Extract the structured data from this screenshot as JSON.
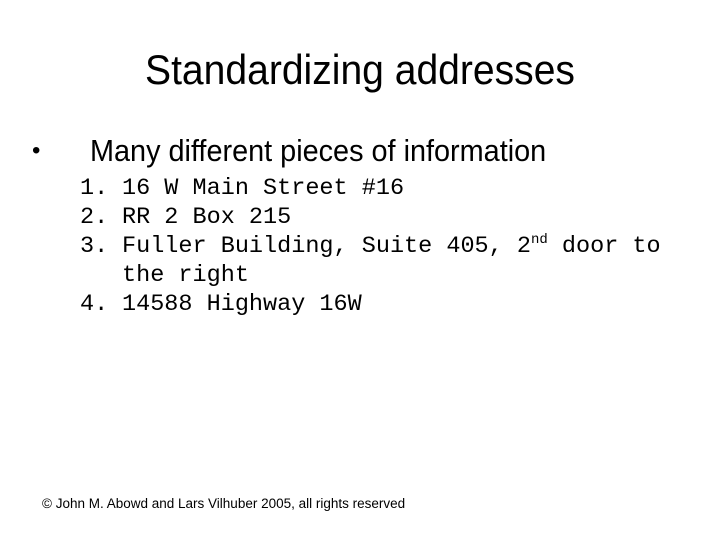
{
  "slide": {
    "title": "Standardizing addresses",
    "bullet": {
      "marker": "•",
      "text": "Many different pieces of information"
    },
    "items": [
      {
        "number": "1.",
        "text": "16 W Main Street #16"
      },
      {
        "number": "2.",
        "text": "RR 2 Box 215"
      },
      {
        "number": "3.",
        "text_before": "Fuller Building, Suite 405, 2",
        "superscript": "nd",
        "text_after": " door to the right"
      },
      {
        "number": "4.",
        "text": "14588 Highway 16W"
      }
    ],
    "footer": "© John M. Abowd and Lars Vilhuber 2005, all rights reserved"
  }
}
